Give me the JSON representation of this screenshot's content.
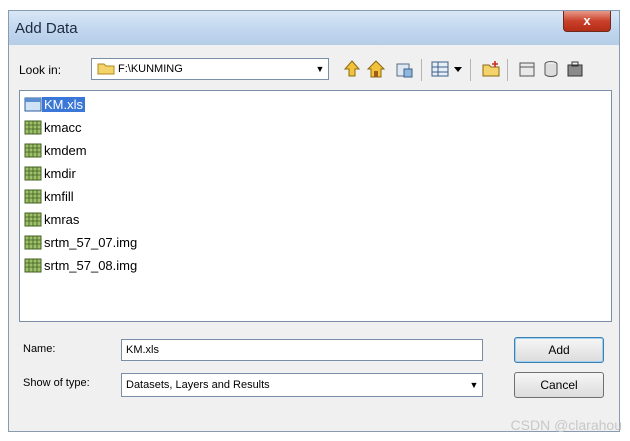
{
  "dialog": {
    "title": "Add Data",
    "close_label": "x"
  },
  "lookin": {
    "label": "Look in:",
    "value": "F:\\KUNMING"
  },
  "toolbar": {
    "icons": [
      "up-one-level-icon",
      "home-icon",
      "connect-folder-icon",
      "list-view-icon",
      "new-folder-icon",
      "catalog-icon",
      "database-icon",
      "toolbox-icon"
    ]
  },
  "files": [
    {
      "name": "KM.xls",
      "icon": "table-icon",
      "selected": true
    },
    {
      "name": "kmacc",
      "icon": "raster-icon"
    },
    {
      "name": "kmdem",
      "icon": "raster-icon"
    },
    {
      "name": "kmdir",
      "icon": "raster-icon"
    },
    {
      "name": "kmfill",
      "icon": "raster-icon"
    },
    {
      "name": "kmras",
      "icon": "raster-icon"
    },
    {
      "name": "srtm_57_07.img",
      "icon": "raster-icon"
    },
    {
      "name": "srtm_57_08.img",
      "icon": "raster-icon"
    }
  ],
  "name_field": {
    "label": "Name:",
    "value": "KM.xls"
  },
  "type_field": {
    "label": "Show of type:",
    "value": "Datasets, Layers and Results"
  },
  "buttons": {
    "add": "Add",
    "cancel": "Cancel"
  },
  "watermark": "CSDN @clarahou"
}
